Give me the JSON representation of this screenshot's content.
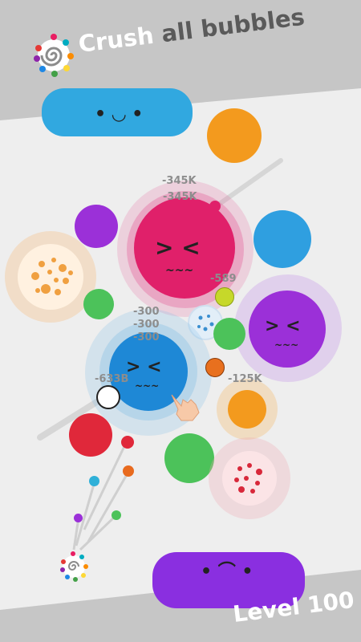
{
  "header": {
    "title_part1": "Crush",
    "title_part2": "all bubbles",
    "logo_icon": "swirl-logo-icon"
  },
  "footer": {
    "level_label": "Level 100"
  },
  "scores": [
    "-345K",
    "-345K",
    "-589",
    "-300",
    "-300",
    "-300",
    "-633B",
    "-125K"
  ],
  "colors": {
    "pink": "#e0206a",
    "purple": "#9b30d8",
    "blue": "#1e88d6",
    "orange": "#f39a1e",
    "green": "#4cc25a",
    "red": "#e0283a",
    "cyan": "#2f9fe0",
    "banner_gray": "#c8c8c8"
  }
}
